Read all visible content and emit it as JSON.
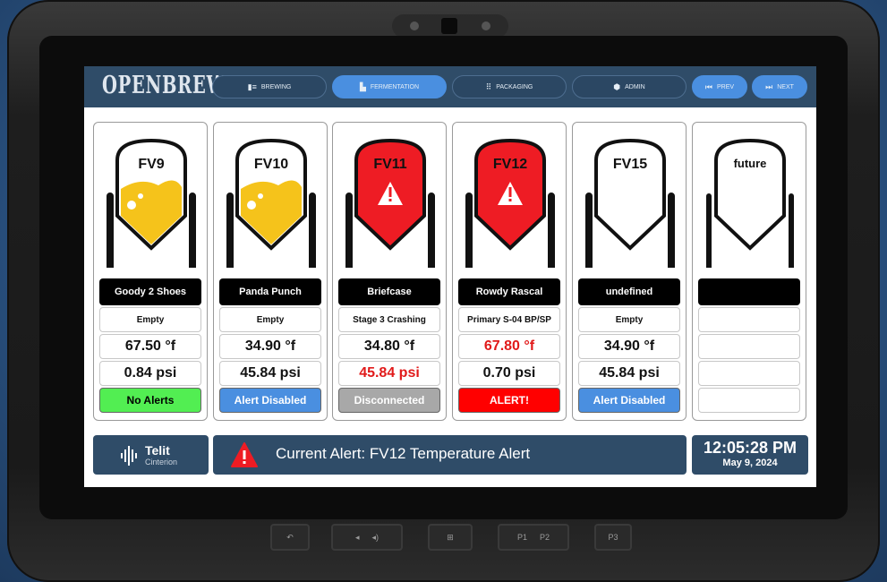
{
  "app": {
    "logo": "OPENBREW"
  },
  "nav": [
    {
      "label": "BREWING",
      "icon": "brewing-icon",
      "active": false
    },
    {
      "label": "FERMENTATION",
      "icon": "fermentation-icon",
      "active": true
    },
    {
      "label": "PACKAGING",
      "icon": "packaging-icon",
      "active": false
    },
    {
      "label": "ADMIN",
      "icon": "admin-icon",
      "active": false
    },
    {
      "label": "PREV",
      "icon": "prev-icon",
      "active": true
    },
    {
      "label": "NEXT",
      "icon": "next-icon",
      "active": true
    }
  ],
  "vessels": [
    {
      "id": "FV9",
      "name": "Goody 2 Shoes",
      "status": "Empty",
      "temp": "67.50 °f",
      "psi": "0.84 psi",
      "alert": "No Alerts",
      "state": "fill",
      "alert_color": "#52ee52",
      "alert_text_color": "#000000"
    },
    {
      "id": "FV10",
      "name": "Panda Punch",
      "status": "Empty",
      "temp": "34.90 °f",
      "psi": "45.84 psi",
      "alert": "Alert Disabled",
      "state": "fill",
      "alert_color": "#4a8fe0",
      "alert_text_color": "#ffffff"
    },
    {
      "id": "FV11",
      "name": "Briefcase",
      "status": "Stage 3 Crashing",
      "temp": "34.80 °f",
      "psi": "45.84 psi",
      "alert": "Disconnected",
      "state": "alarm",
      "alert_color": "#a8a8a8",
      "alert_text_color": "#ffffff",
      "psi_red": true
    },
    {
      "id": "FV12",
      "name": "Rowdy Rascal",
      "status": "Primary S-04 BP/SP",
      "temp": "67.80 °f",
      "psi": "0.70 psi",
      "alert": "ALERT!",
      "state": "alarm",
      "alert_color": "#ff0000",
      "alert_text_color": "#ffffff",
      "temp_red": true
    },
    {
      "id": "FV15",
      "name": "undefined",
      "status": "Empty",
      "temp": "34.90 °f",
      "psi": "45.84 psi",
      "alert": "Alert Disabled",
      "state": "empty",
      "alert_color": "#4a8fe0",
      "alert_text_color": "#ffffff"
    },
    {
      "id": "future",
      "name": "",
      "status": "",
      "temp": "",
      "psi": "",
      "alert": "",
      "state": "outline",
      "alert_color": "#ffffff",
      "alert_text_color": "#000000"
    }
  ],
  "footer": {
    "brand_name": "Telit",
    "brand_sub": "Cinterion",
    "alert_text": "Current Alert: FV12 Temperature Alert",
    "time": "12:05:28 PM",
    "date": "May 9, 2024"
  },
  "hardware": {
    "buttons": [
      "back",
      "volume-down",
      "volume-up",
      "windows",
      "P1",
      "P2",
      "P3"
    ]
  },
  "colors": {
    "header": "#2f4c68",
    "accent": "#4a8fe0",
    "beer": "#f5c31b",
    "alarm": "#ee1c24"
  }
}
